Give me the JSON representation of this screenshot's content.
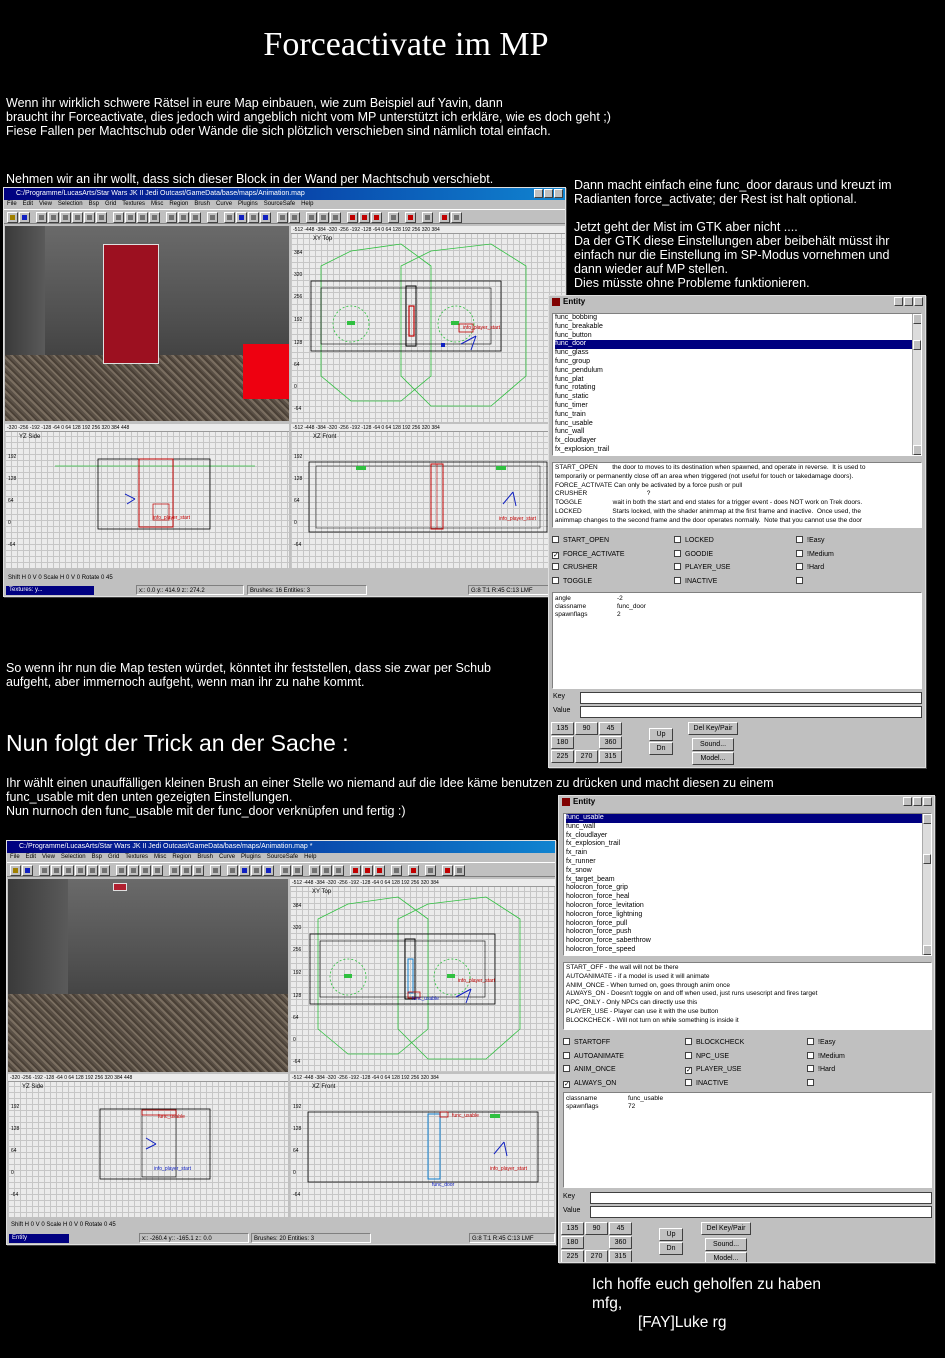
{
  "title": "Forceactivate im MP",
  "intro": "Wenn ihr wirklich schwere Rätsel in eure Map einbauen, wie zum Beispiel auf Yavin, dann\nbraucht ihr Forceactivate, dies jedoch wird angeblich nicht vom MP unterstützt ich erkläre, wie es doch geht ;)\nFiese Fallen per Machtschub oder Wände die sich plötzlich verschieben sind nämlich total einfach.",
  "block_caption": "Nehmen wir an ihr wollt, dass sich dieser Block in der Wand per Machtschub verschiebt.",
  "right_text": "Dann macht einfach eine func_door daraus und kreuzt im\nRadianten force_activate; der Rest ist halt optional.\n\nJetzt geht der Mist im GTK aber nicht ....\nDa der GTK diese Einstellungen aber beibehält müsst ihr\neinfach nur die Einstellung im SP-Modus vornehmen und\n dann wieder auf MP stellen.\nDies müsste ohne Probleme funktionieren.",
  "test_text": "So wenn ihr nun die Map testen würdet, könntet ihr feststellen, dass sie zwar per Schub\naufgeht, aber immernoch aufgeht, wenn man ihr zu nahe kommt.",
  "trick_heading": "Nun folgt der Trick an der Sache :",
  "trick_text": "Ihr wählt einen unauffälligen kleinen Brush an einer Stelle wo niemand auf die Idee käme benutzen zu drücken und macht diesen zu einem\nfunc_usable mit den unten gezeigten Einstellungen.\nNun nurnoch den func_usable mit der func_door verknüpfen und fertig :)",
  "signature": {
    "line1": "Ich hoffe euch geholfen zu haben",
    "line2": "mfg,",
    "line3": "[FAY]Luke rg"
  },
  "editor1": {
    "title": "C:/Programme/LucasArts/Star Wars JK II Jedi Outcast/GameData/base/maps/Animation.map",
    "menu": [
      "File",
      "Edit",
      "View",
      "Selection",
      "Bsp",
      "Grid",
      "Textures",
      "Misc",
      "Region",
      "Brush",
      "Curve",
      "Plugins",
      "SourceSafe",
      "Help"
    ],
    "xy_label": "XY Top",
    "yz_label": "YZ Side",
    "xz_label": "XZ Front",
    "ruler": "-512 -448 -384 -320 -256 -192 -128 -64 0 64 128 192 256 320 384",
    "ruler_side": "-320 -256 -192 -128 -64 0 64 128 192 256 320 384 448",
    "start_label": "info_player_start",
    "controls": "Shift H  0   V  0    Scale H  0   V  0    Rotate  0   45",
    "status_task": "Textures: y...",
    "status_coords": "x:: 0.0  y:: 414.9  z:: 274.2",
    "status_brushes": "Brushes: 16 Entities: 3",
    "status_grid": "G:8 T:1 R:45 C:13 LMF"
  },
  "editor2": {
    "title": "C:/Programme/LucasArts/Star Wars JK II Jedi Outcast/GameData/base/maps/Animation.map *",
    "menu": [
      "File",
      "Edit",
      "View",
      "Selection",
      "Bsp",
      "Grid",
      "Textures",
      "Misc",
      "Region",
      "Brush",
      "Curve",
      "Plugins",
      "SourceSafe",
      "Help"
    ],
    "xy_label": "XY Top",
    "yz_label": "YZ Side",
    "xz_label": "XZ Front",
    "ruler": "-512 -448 -384 -320 -256 -192 -128 -64 0 64 128 192 256 320 384",
    "ruler_side": "-320 -256 -192 -128 -64 0 64 128 192 256 320 384 448",
    "start_label": "info_player_start",
    "usable_label": "func_usable",
    "door_label": "func_door",
    "controls": "Shift H  0   V  0    Scale H  0   V  0    Rotate  0   45",
    "status_task": "Entity",
    "status_coords": "x:: -260.4  y:: -165.1  z:: 0.0",
    "status_brushes": "Brushes: 20 Entities: 3",
    "status_grid": "G:8 T:1 R:45 C:13 LMF"
  },
  "entity1": {
    "title": "Entity",
    "classes": [
      "func_bobbing",
      "func_breakable",
      "func_button",
      "func_door",
      "func_glass",
      "func_group",
      "func_pendulum",
      "func_plat",
      "func_rotating",
      "func_static",
      "func_timer",
      "func_train",
      "func_usable",
      "func_wall",
      "fx_cloudlayer",
      "fx_explosion_trail"
    ],
    "selected": "func_door",
    "desc": [
      "START_OPEN        the door to moves to its destination when spawned, and operate in reverse.  It is used to",
      "temporarily or permanently close off an area when triggered (not useful for touch or takedamage doors).",
      "FORCE_ACTIVATE Can only be activated by a force push or pull",
      "CRUSHER                                 ?",
      "TOGGLE                 wait in both the start and end states for a trigger event - does NOT work on Trek doors.",
      "LOCKED                 Starts locked, with the shader animmap at the first frame and inactive.  Once used, the",
      "animmap changes to the second frame and the door operates normally.  Note that you cannot use the door"
    ],
    "flags": [
      "START_OPEN",
      "LOCKED",
      "!Easy",
      "FORCE_ACTIVATE",
      "GOODIE",
      "!Medium",
      "CRUSHER",
      "PLAYER_USE",
      "!Hard",
      "TOGGLE",
      "INACTIVE",
      ""
    ],
    "checked": [
      false,
      false,
      false,
      true,
      false,
      false,
      false,
      false,
      false,
      false,
      false,
      false
    ],
    "properties": [
      {
        "key": "angle",
        "value": "-2"
      },
      {
        "key": "classname",
        "value": "func_door"
      },
      {
        "key": "spawnflags",
        "value": "2"
      }
    ],
    "key_label": "Key",
    "value_label": "Value",
    "angles": [
      "135",
      "90",
      "45",
      "180",
      "",
      "360",
      "225",
      "270",
      "315"
    ],
    "up": "Up",
    "dn": "Dn",
    "del_key": "Del Key/Pair",
    "sound": "Sound...",
    "model": "Model..."
  },
  "entity2": {
    "title": "Entity",
    "classes": [
      "func_usable",
      "func_wall",
      "fx_cloudlayer",
      "fx_explosion_trail",
      "fx_rain",
      "fx_runner",
      "fx_snow",
      "fx_target_beam",
      "holocron_force_grip",
      "holocron_force_heal",
      "holocron_force_levitation",
      "holocron_force_lightning",
      "holocron_force_pull",
      "holocron_force_push",
      "holocron_force_saberthrow",
      "holocron_force_speed"
    ],
    "selected": "func_usable",
    "desc": [
      "START_OFF - the wall will not be there",
      "AUTOANIMATE - if a model is used it will animate",
      "ANIM_ONCE - When turned on, goes through anim once",
      "ALWAYS_ON - Doesn't toggle on and off when used, just runs usescript and fires target",
      "NPC_ONLY - Only NPCs can directly use this",
      "PLAYER_USE - Player can use it with the use button",
      "BLOCKCHECK - Will not turn on while something is inside it"
    ],
    "flags": [
      "STARTOFF",
      "BLOCKCHECK",
      "!Easy",
      "AUTOANIMATE",
      "NPC_USE",
      "!Medium",
      "ANIM_ONCE",
      "PLAYER_USE",
      "!Hard",
      "ALWAYS_ON",
      "INACTIVE",
      ""
    ],
    "checked": [
      false,
      false,
      false,
      false,
      false,
      false,
      false,
      true,
      false,
      true,
      false,
      false
    ],
    "properties": [
      {
        "key": "classname",
        "value": "func_usable"
      },
      {
        "key": "spawnflags",
        "value": "72"
      }
    ],
    "key_label": "Key",
    "value_label": "Value",
    "angles": [
      "135",
      "90",
      "45",
      "180",
      "",
      "360",
      "225",
      "270",
      "315"
    ],
    "up": "Up",
    "dn": "Dn",
    "del_key": "Del Key/Pair",
    "sound": "Sound...",
    "model": "Model..."
  },
  "colors": {
    "background": "#000000",
    "text": "#ffffff",
    "window_face": "#c0c0c0",
    "titlebar": "#000080",
    "selection": "#000080",
    "red_block": "#cc1020",
    "brush_green": "#30c040"
  }
}
